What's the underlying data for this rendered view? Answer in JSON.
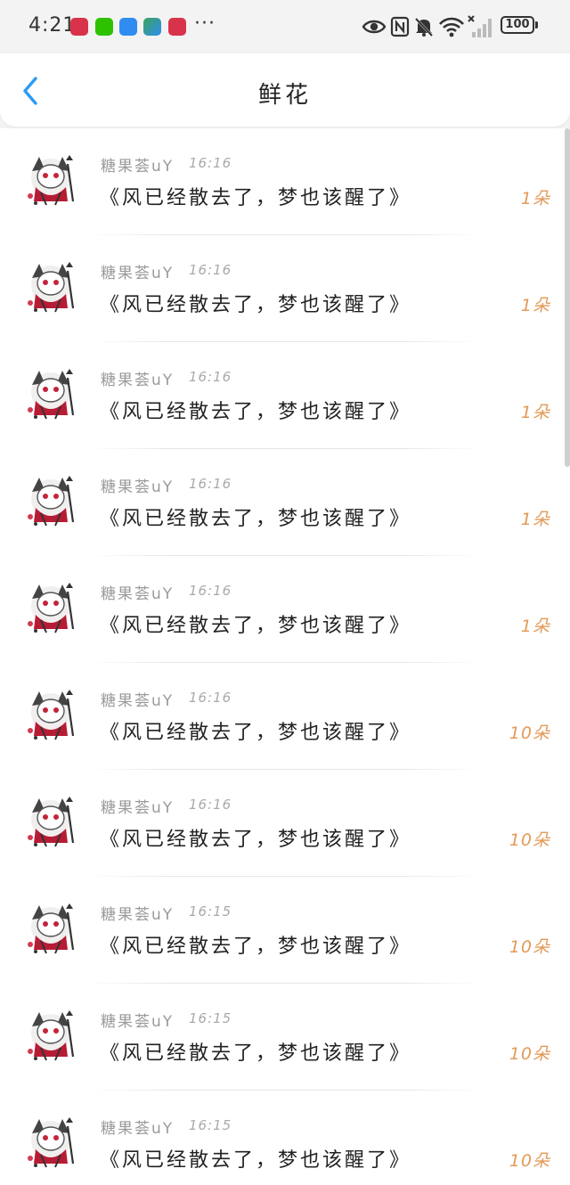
{
  "status_bar": {
    "time": "4:21",
    "more": "···",
    "battery": "100",
    "app_icons": [
      {
        "name": "huawei-app-icon",
        "color": "#d8334a"
      },
      {
        "name": "wechat-icon",
        "color": "#2dc100"
      },
      {
        "name": "blue-app-icon",
        "color": "#2f8cf0"
      },
      {
        "name": "game-app-icon",
        "color": "#3aa55c"
      },
      {
        "name": "huawei-store-icon",
        "color": "#d8334a"
      }
    ]
  },
  "header": {
    "title": "鲜花",
    "back_color": "#2b9bf4"
  },
  "colors": {
    "amount": "#e39a58",
    "sender": "#9a9a9a"
  },
  "items": [
    {
      "sender": "糖果荟uY",
      "time": "16:16",
      "message": "《风已经散去了，梦也该醒了》",
      "amount": "1朵"
    },
    {
      "sender": "糖果荟uY",
      "time": "16:16",
      "message": "《风已经散去了，梦也该醒了》",
      "amount": "1朵"
    },
    {
      "sender": "糖果荟uY",
      "time": "16:16",
      "message": "《风已经散去了，梦也该醒了》",
      "amount": "1朵"
    },
    {
      "sender": "糖果荟uY",
      "time": "16:16",
      "message": "《风已经散去了，梦也该醒了》",
      "amount": "1朵"
    },
    {
      "sender": "糖果荟uY",
      "time": "16:16",
      "message": "《风已经散去了，梦也该醒了》",
      "amount": "1朵"
    },
    {
      "sender": "糖果荟uY",
      "time": "16:16",
      "message": "《风已经散去了，梦也该醒了》",
      "amount": "10朵"
    },
    {
      "sender": "糖果荟uY",
      "time": "16:16",
      "message": "《风已经散去了，梦也该醒了》",
      "amount": "10朵"
    },
    {
      "sender": "糖果荟uY",
      "time": "16:15",
      "message": "《风已经散去了，梦也该醒了》",
      "amount": "10朵"
    },
    {
      "sender": "糖果荟uY",
      "time": "16:15",
      "message": "《风已经散去了，梦也该醒了》",
      "amount": "10朵"
    },
    {
      "sender": "糖果荟uY",
      "time": "16:15",
      "message": "《风已经散去了，梦也该醒了》",
      "amount": "10朵"
    }
  ]
}
